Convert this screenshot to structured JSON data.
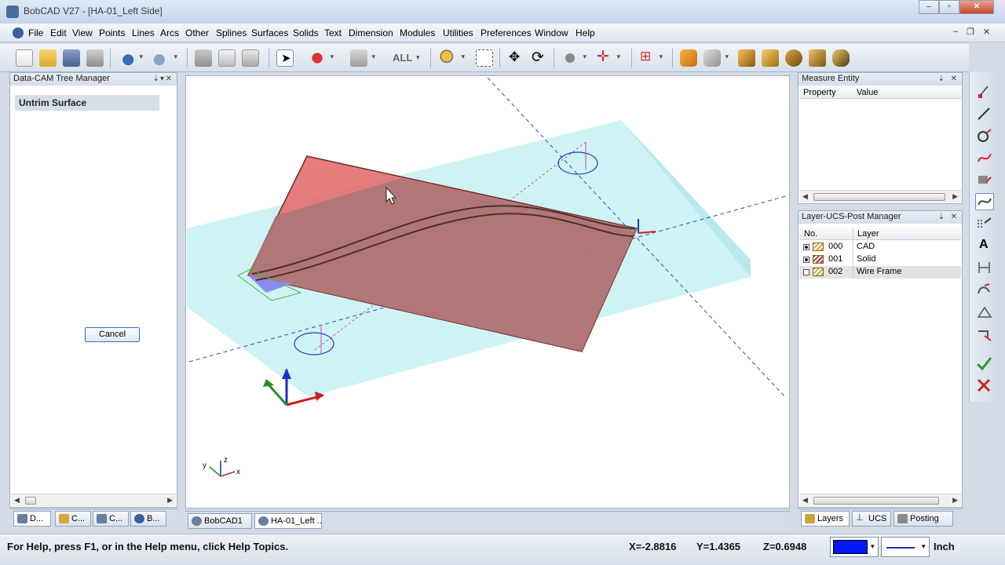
{
  "window": {
    "title": "BobCAD V27 - [HA-01_Left Side]"
  },
  "menu": {
    "items": [
      "File",
      "Edit",
      "View",
      "Points",
      "Lines",
      "Arcs",
      "Other",
      "Splines",
      "Surfaces",
      "Solids",
      "Text",
      "Dimension",
      "Modules",
      "Utilities",
      "Preferences",
      "Window",
      "Help"
    ]
  },
  "toolbar": {
    "filter_label": "ALL"
  },
  "tree_manager": {
    "title": "Data-CAM Tree Manager",
    "heading": "Untrim Surface",
    "cancel_label": "Cancel",
    "tabs": [
      "D...",
      "C...",
      "C...",
      "B..."
    ]
  },
  "measure_entity": {
    "title": "Measure Entity",
    "columns": [
      "Property",
      "Value"
    ]
  },
  "layer_manager": {
    "title": "Layer-UCS-Post Manager",
    "columns": [
      "No.",
      "Layer"
    ],
    "rows": [
      {
        "no": "000",
        "name": "CAD",
        "visible": true
      },
      {
        "no": "001",
        "name": "Solid",
        "visible": true
      },
      {
        "no": "002",
        "name": "Wire Frame",
        "visible": false
      }
    ],
    "tabs": [
      "Layers",
      "UCS",
      "Posting"
    ]
  },
  "doc_tabs": [
    "BobCAD1",
    "HA-01_Left ..."
  ],
  "status": {
    "help_text": "For Help, press F1, or in the Help menu, click Help Topics.",
    "x": "X=-2.8816",
    "y": "Y=1.4365",
    "z": "Z=0.6948",
    "units": "Inch",
    "color_swatch": "#0016ff"
  },
  "axis_triad": {
    "x_label": "x",
    "y_label": "y",
    "z_label": "z"
  }
}
